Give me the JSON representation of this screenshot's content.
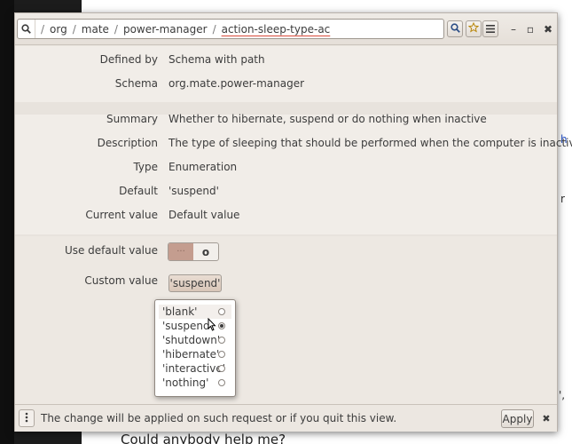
{
  "background": {
    "fragments": [
      {
        "text": "h",
        "color": "#2a55c9"
      },
      {
        "text": "r",
        "color": "#333333"
      },
      {
        "text": "',",
        "color": "#333333"
      }
    ],
    "bottom_text": "Could anybody help me?"
  },
  "pathbar": {
    "icon": "search-icon",
    "segments": [
      "org",
      "mate",
      "power-manager",
      "action-sleep-type-ac"
    ],
    "separator": "/"
  },
  "header_buttons": {
    "search_icon": "search-icon",
    "bookmark_icon": "star-icon",
    "menu_icon": "hamburger-menu-icon"
  },
  "window_controls": {
    "minimize": "–",
    "maximize": "▫",
    "close": "✖"
  },
  "schema_section": {
    "defined_by_label": "Defined by",
    "defined_by_value": "Schema with path",
    "schema_label": "Schema",
    "schema_value": "org.mate.power-manager"
  },
  "info_section": {
    "summary_label": "Summary",
    "summary_value": "Whether to hibernate, suspend or do nothing when inactive",
    "description_label": "Description",
    "description_value": "The type of sleeping that should be performed when the computer is inactive.",
    "type_label": "Type",
    "type_value": "Enumeration",
    "default_label": "Default",
    "default_value": "'suspend'",
    "current_label": "Current value",
    "current_value": "Default value"
  },
  "edit_section": {
    "use_default_label": "Use default value",
    "use_default_on": false,
    "switch_on_glyph": "···",
    "switch_off_glyph": "o",
    "custom_value_label": "Custom value",
    "custom_value_selected": "'suspend'"
  },
  "popup": {
    "options": [
      {
        "label": "'blank'",
        "checked": false
      },
      {
        "label": "'suspend'",
        "checked": true
      },
      {
        "label": "'shutdown'",
        "checked": false
      },
      {
        "label": "'hibernate'",
        "checked": false
      },
      {
        "label": "'interactive'",
        "checked": false
      },
      {
        "label": "'nothing'",
        "checked": false
      }
    ]
  },
  "footer": {
    "menu_icon": "vertical-dots-icon",
    "message": "The change will be applied on such request or if you quit this view.",
    "apply_label": "Apply",
    "close_glyph": "✖"
  },
  "colors": {
    "window_bg": "#ede8e2",
    "switch_accent": "#c49d8f",
    "current_underline": "#d84a3a"
  }
}
